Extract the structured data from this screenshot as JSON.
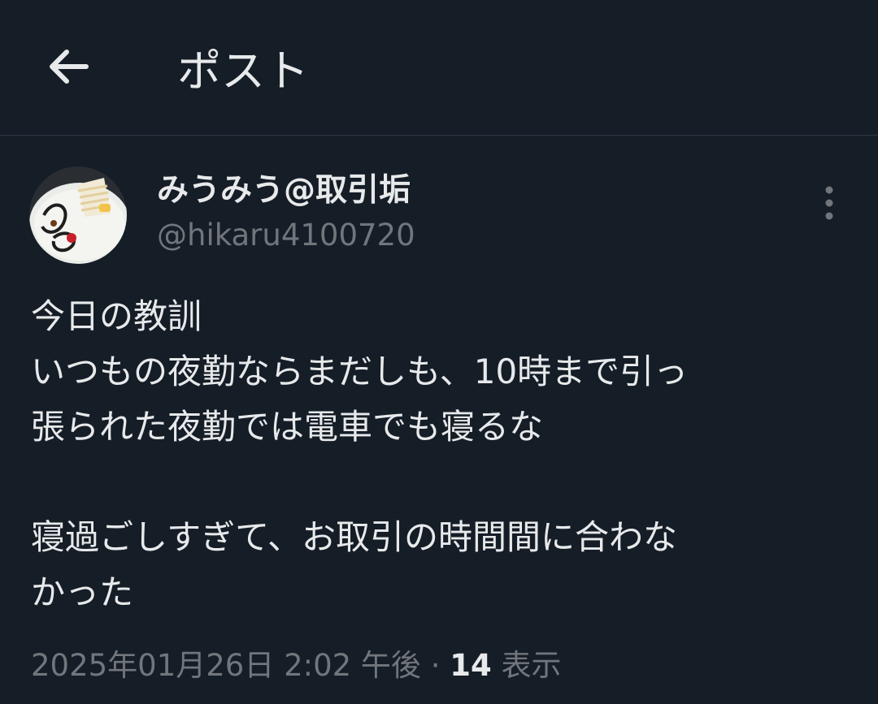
{
  "header": {
    "title": "ポスト",
    "back_icon": "arrow-left-icon"
  },
  "author": {
    "display_name": "みうみう@取引垢",
    "handle": "@hikaru4100720",
    "avatar_icon": "avatar-cake-plate"
  },
  "post": {
    "lines": [
      "今日の教訓",
      "いつもの夜勤ならまだしも、10時まで引っ",
      "張られた夜勤では電車でも寝るな",
      "",
      "寝過ごしすぎて、お取引の時間間に合わな",
      "かった"
    ]
  },
  "meta": {
    "timestamp": "2025年01月26日 2:02 午後",
    "separator": "·",
    "views_count": "14",
    "views_label": "表示"
  },
  "colors": {
    "background": "#151d27",
    "text_primary": "#e7e9ea",
    "text_secondary": "#71767b",
    "divider": "#303a45"
  }
}
